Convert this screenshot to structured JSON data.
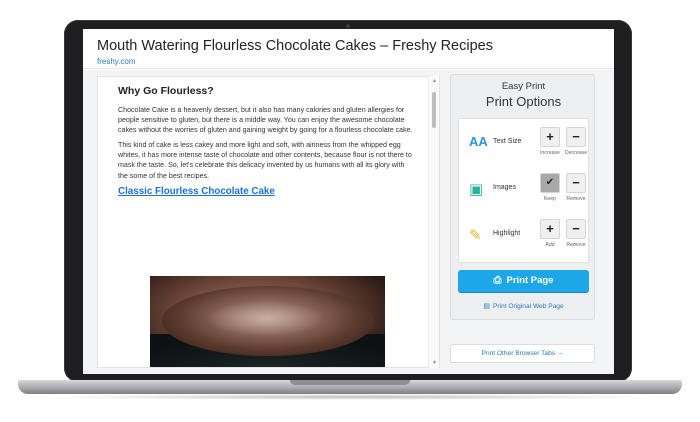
{
  "page": {
    "title": "Mouth Watering Flourless Chocolate Cakes – Freshy Recipes",
    "site": "freshy.com"
  },
  "article": {
    "heading": "Why Go Flourless?",
    "paragraphs": [
      "Chocolate Cake is a heavenly dessert, but it also has many calories and gluten allergies for people sensitive to gluten, but there is a middle way. You can enjoy the awesome chocolate cakes without the worries of gluten and gaining weight by going for a flourless chocolate cake.",
      "This kind of cake is less cakey and more light and soft, with airiness from the whipped egg whites, it has more intense taste of chocolate and other contents, because flour is not there to mask the taste. So, let's celebrate this delicacy invented by us humans with all its glory with the some of the best recipes."
    ],
    "subheading_link": "Classic Flourless Chocolate Cake",
    "image": "chocolate-cake-photo"
  },
  "panel": {
    "title_small": "Easy Print",
    "title_large": "Print Options",
    "rows": [
      {
        "label": "Text Size",
        "icon": "text-size-icon",
        "icon_glyph": "AA",
        "left_btn": "+",
        "left_cap": "Increase",
        "right_btn": "−",
        "right_cap": "Decrease"
      },
      {
        "label": "Images",
        "icon": "image-icon",
        "icon_glyph": "▣",
        "left_btn": "✔",
        "left_cap": "Keep",
        "right_btn": "−",
        "right_cap": "Remove"
      },
      {
        "label": "Highlight",
        "icon": "highlighter-icon",
        "icon_glyph": "✎",
        "left_btn": "+",
        "left_cap": "Add",
        "right_btn": "−",
        "right_cap": "Remove"
      }
    ],
    "print_button": "Print Page",
    "original_link": "Print Original Web Page",
    "other_tabs": "Print Other Browser Tabs →"
  },
  "colors": {
    "accent": "#1ea7e8",
    "link": "#2a7ab8",
    "heading_link": "#1a6fd8"
  }
}
